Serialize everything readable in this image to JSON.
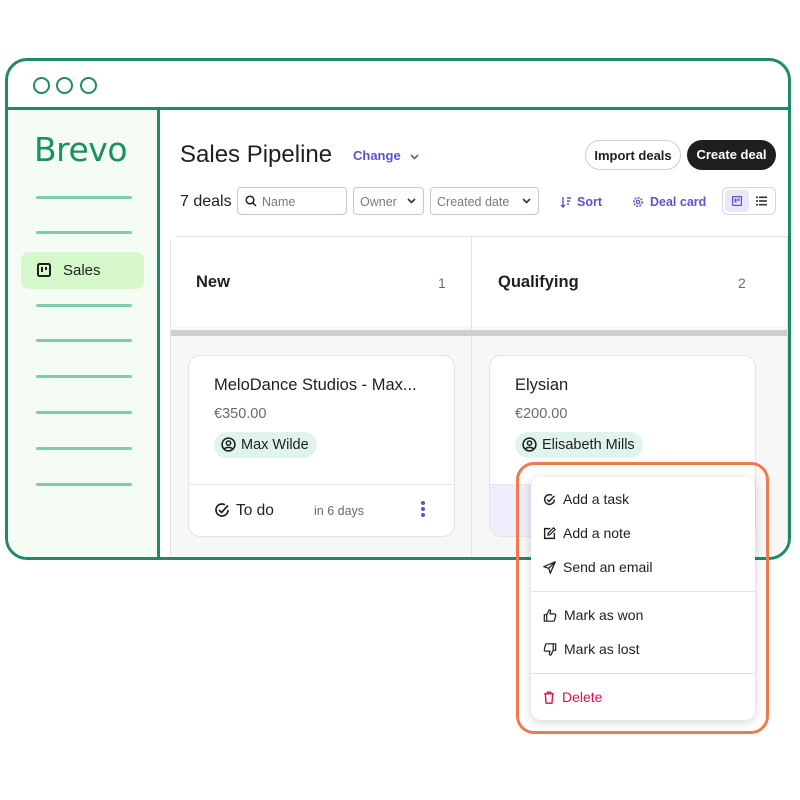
{
  "app": {
    "logo": "Brevo"
  },
  "sidebar": {
    "active_item": {
      "label": "Sales",
      "icon": "board-icon"
    }
  },
  "header": {
    "title": "Sales Pipeline",
    "change_label": "Change",
    "import_label": "Import deals",
    "create_label": "Create deal"
  },
  "toolbar": {
    "deals_count": "7 deals",
    "search_placeholder": "Name",
    "owner_label": "Owner",
    "date_label": "Created date",
    "sort_label": "Sort",
    "deal_card_label": "Deal card"
  },
  "columns": [
    {
      "title": "New",
      "count": "1"
    },
    {
      "title": "Qualifying",
      "count": "2"
    }
  ],
  "cards": [
    {
      "title": "MeloDance Studios - Max...",
      "amount": "€350.00",
      "owner": "Max Wilde",
      "task": "To do",
      "due": "in 6 days"
    },
    {
      "title": "Elysian",
      "amount": "€200.00",
      "owner": "Elisabeth Mills"
    }
  ],
  "context_menu": {
    "add_task": "Add a task",
    "add_note": "Add a note",
    "send_email": "Send an email",
    "mark_won": "Mark as won",
    "mark_lost": "Mark as lost",
    "delete": "Delete"
  },
  "colors": {
    "brand_green": "#1f8a68",
    "accent_purple": "#5b55c8",
    "highlight_orange": "#f07a4c",
    "delete_red": "#d4134b"
  }
}
